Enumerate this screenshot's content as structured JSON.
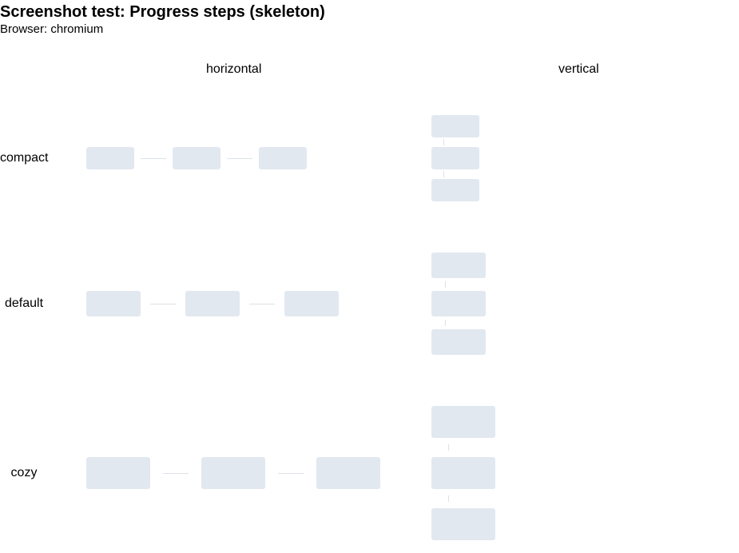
{
  "page": {
    "title": "Screenshot test: Progress steps (skeleton)",
    "browser_line": "Browser: chromium"
  },
  "columns": {
    "horizontal": "horizontal",
    "vertical": "vertical"
  },
  "rows": {
    "compact": "compact",
    "default": "default",
    "cozy": "cozy"
  },
  "colors": {
    "skeleton_fill": "#e2e8f0",
    "connector": "#dde2e8"
  }
}
